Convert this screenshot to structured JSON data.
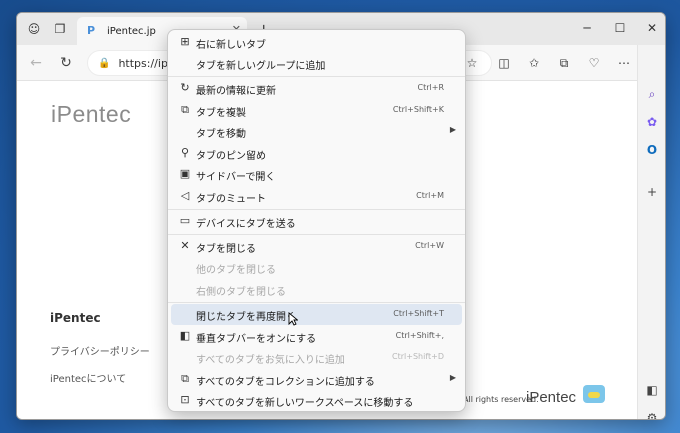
{
  "browser": {
    "tab_title": "iPentec.jp",
    "url": "https://ipen"
  },
  "page": {
    "logo": "iPentec",
    "footer_title": "iPentec",
    "footer_links": [
      "プライバシーポリシー",
      "iPentecについて"
    ],
    "copyright": "All rights reserved.",
    "footer_logo": "iPentec"
  },
  "context_menu": {
    "items": [
      {
        "label": "右に新しいタブ",
        "shortcut": "",
        "icon": "new-tab-icon",
        "disabled": false,
        "submenu": false
      },
      {
        "label": "タブを新しいグループに追加",
        "shortcut": "",
        "icon": "",
        "disabled": false,
        "submenu": false
      },
      {
        "label": "最新の情報に更新",
        "shortcut": "Ctrl+R",
        "icon": "refresh-icon",
        "disabled": false,
        "submenu": false
      },
      {
        "label": "タブを複製",
        "shortcut": "Ctrl+Shift+K",
        "icon": "duplicate-icon",
        "disabled": false,
        "submenu": false
      },
      {
        "label": "タブを移動",
        "shortcut": "",
        "icon": "",
        "disabled": false,
        "submenu": true
      },
      {
        "label": "タブのピン留め",
        "shortcut": "",
        "icon": "pin-icon",
        "disabled": false,
        "submenu": false
      },
      {
        "label": "サイドバーで開く",
        "shortcut": "",
        "icon": "sidebar-icon",
        "disabled": false,
        "submenu": false
      },
      {
        "label": "タブのミュート",
        "shortcut": "Ctrl+M",
        "icon": "speaker-icon",
        "disabled": false,
        "submenu": false
      },
      {
        "label": "デバイスにタブを送る",
        "shortcut": "",
        "icon": "device-icon",
        "disabled": false,
        "submenu": false
      },
      {
        "label": "タブを閉じる",
        "shortcut": "Ctrl+W",
        "icon": "close-icon",
        "disabled": false,
        "submenu": false
      },
      {
        "label": "他のタブを閉じる",
        "shortcut": "",
        "icon": "",
        "disabled": true,
        "submenu": false
      },
      {
        "label": "右側のタブを閉じる",
        "shortcut": "",
        "icon": "",
        "disabled": true,
        "submenu": false
      },
      {
        "label": "閉じたタブを再度開く",
        "shortcut": "Ctrl+Shift+T",
        "icon": "",
        "disabled": false,
        "submenu": false
      },
      {
        "label": "垂直タブバーをオンにする",
        "shortcut": "Ctrl+Shift+,",
        "icon": "vertical-tabs-icon",
        "disabled": false,
        "submenu": false
      },
      {
        "label": "すべてのタブをお気に入りに追加",
        "shortcut": "Ctrl+Shift+D",
        "icon": "",
        "disabled": true,
        "submenu": false
      },
      {
        "label": "すべてのタブをコレクションに追加する",
        "shortcut": "",
        "icon": "collections-icon",
        "disabled": false,
        "submenu": true
      },
      {
        "label": "すべてのタブを新しいワークスペースに移動する",
        "shortcut": "",
        "icon": "workspace-icon",
        "disabled": false,
        "submenu": false
      }
    ]
  }
}
